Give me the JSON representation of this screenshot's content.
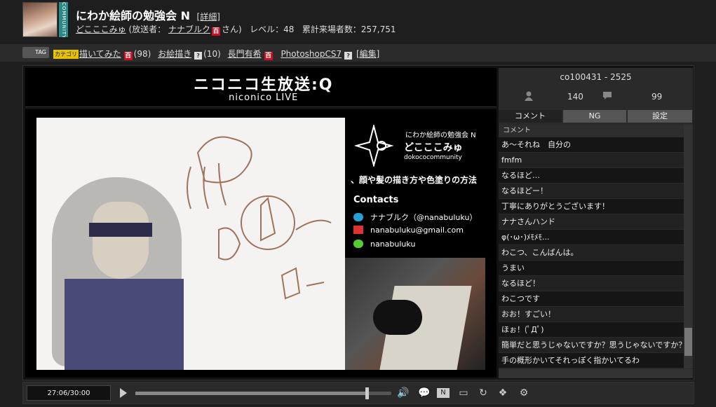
{
  "header": {
    "community_label": "COMMUNITY",
    "title": "にわか絵師の勉強会 N",
    "details_link": "[詳細]",
    "owner_name": "どこここみゅ",
    "broadcaster_prefix": "(放送者：",
    "broadcaster_name": "ナナブルク",
    "broadcaster_badge": "百",
    "broadcaster_suffix": "さん)",
    "level": "レベル：48",
    "total_visitors": "累計来場者数：257,751"
  },
  "tagbar": {
    "tag_label": "TAG",
    "category_badge": "カテゴリ",
    "tags": [
      {
        "name": "描いてみた",
        "badge": "百",
        "badge_type": "hyaku",
        "count": "(98)"
      },
      {
        "name": "お絵描き",
        "badge": "?",
        "badge_type": "q",
        "count": "(10)"
      },
      {
        "name": "長門有希",
        "badge": "百",
        "badge_type": "hyaku",
        "count": ""
      },
      {
        "name": "PhotoshopCS7",
        "badge": "?",
        "badge_type": "q",
        "count": ""
      }
    ],
    "edit_link": "[編集]"
  },
  "player": {
    "logo_main": "ニコニコ生放送:Q",
    "logo_sub": "niconico LIVE",
    "stream_overlay": {
      "community_title": "にわか絵師の勉強会 N",
      "owner_name": "どこここみゅ",
      "owner_id": "dokococommunity",
      "topic": "、顔や髪の描き方や色塗りの方法",
      "contacts_title": "Contacts",
      "twitter": "ナナブルク（@nanabuluku）",
      "email": "nanabuluku@gmail.com",
      "skype": "nanabuluku"
    }
  },
  "side_panel": {
    "live_id": "co100431 - 2525",
    "viewers": "140",
    "comments_count": "99",
    "tabs": [
      "コメント",
      "NG",
      "設定"
    ],
    "comment_header": "コメント",
    "comments": [
      "あ～それね　自分の",
      "fmfm",
      "なるほど…",
      "なるほどー！",
      "丁寧にありがとうございます！",
      "ナナさんハンド",
      "φ(･ω･)ﾒﾓﾒﾓ...",
      "わこつ、こんばんは。",
      "うまい",
      "なるほど！",
      "わこつです",
      "おお！すごい！",
      "ほぉ！(ﾟДﾟ)",
      "簡単だと思うじゃないですか？思うじゃないですか？",
      "手の概形かいてそれっぽく指かいてるわ"
    ]
  },
  "controls": {
    "time": "27:06/30:00",
    "progress": 0.9033,
    "icons": [
      "play-icon",
      "volume-icon",
      "comment-icon",
      "nicoscript-icon",
      "screen-icon",
      "reload-icon",
      "app-icon",
      "settings-icon"
    ]
  }
}
